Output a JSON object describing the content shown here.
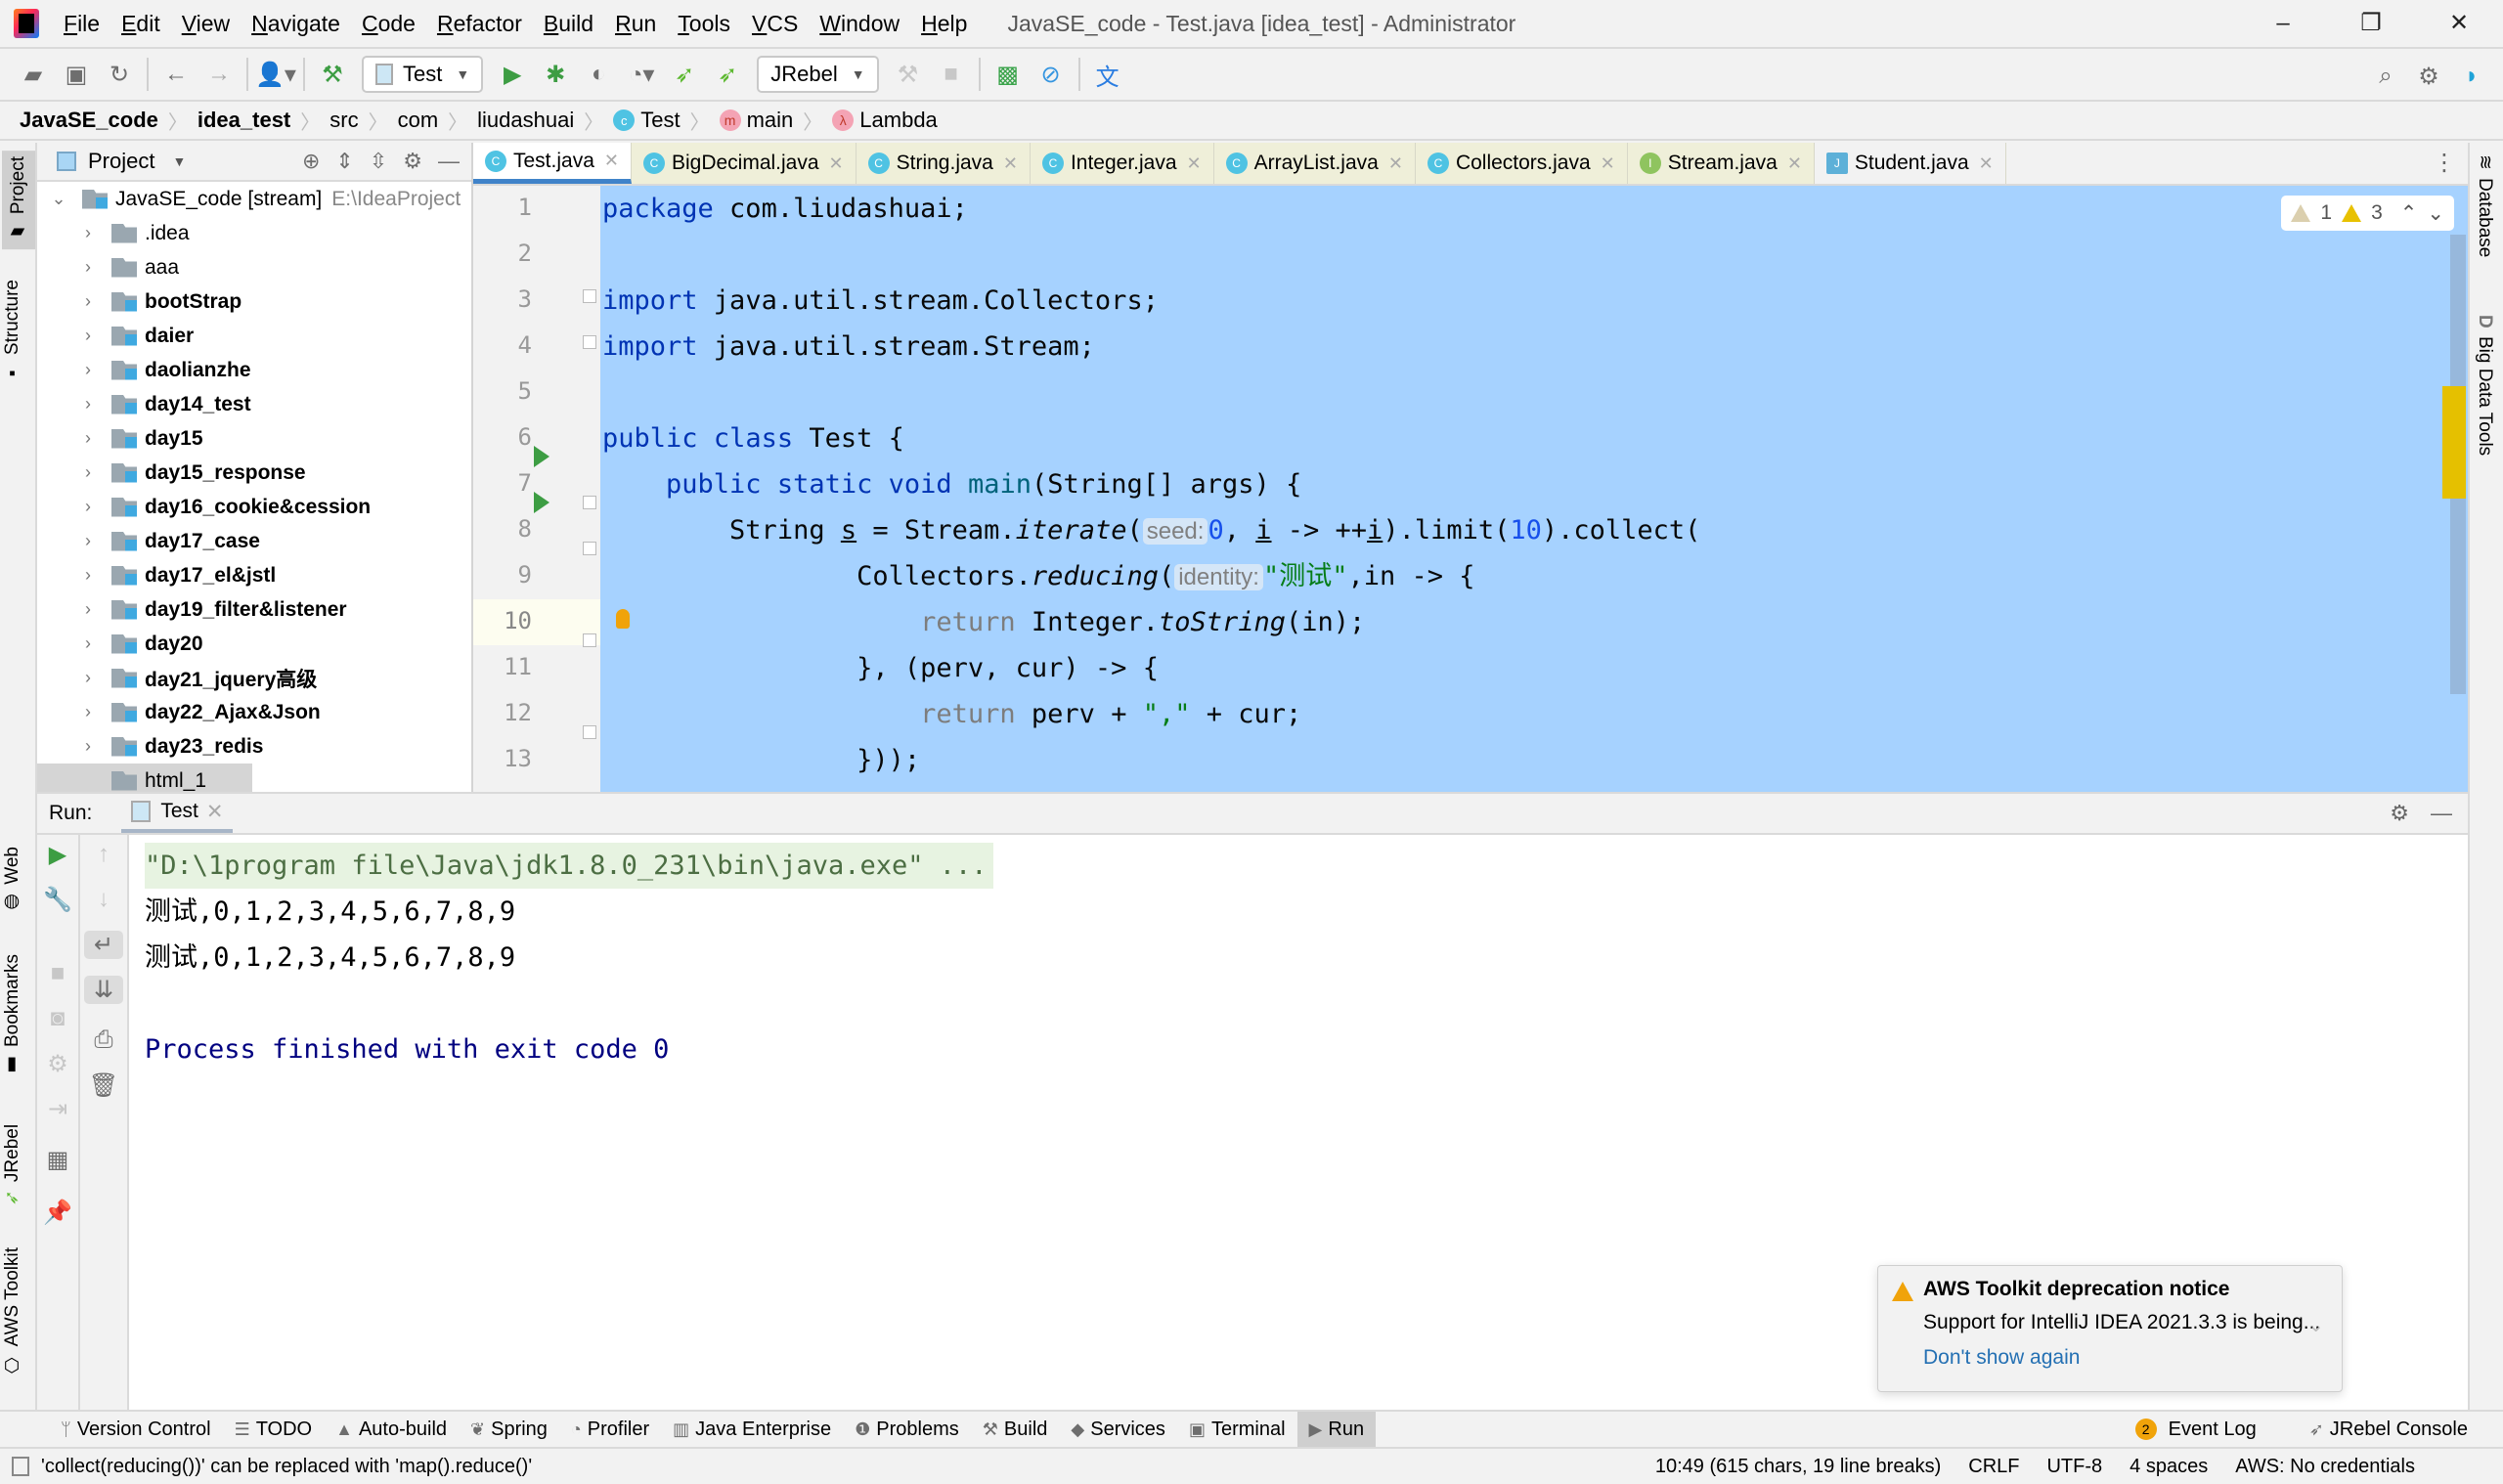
{
  "window": {
    "title": "JavaSE_code - Test.java [idea_test] - Administrator",
    "controls": {
      "minimize": "–",
      "restore": "❐",
      "close": "✕"
    }
  },
  "menu": [
    "File",
    "Edit",
    "View",
    "Navigate",
    "Code",
    "Refactor",
    "Build",
    "Run",
    "Tools",
    "VCS",
    "Window",
    "Help"
  ],
  "toolbar": {
    "run_config": "Test",
    "jrebel_config": "JRebel",
    "icons": [
      "open-icon",
      "save-icon",
      "sync-icon",
      "back-icon",
      "forward-icon",
      "user-icon",
      "build-hammer-icon",
      "run-icon",
      "debug-icon",
      "coverage-icon",
      "profile-icon",
      "jrebel-run-icon",
      "jrebel-debug-icon",
      "rebuild-icon",
      "stop-icon",
      "monitor-icon",
      "power-save-icon",
      "translate-icon",
      "search-icon",
      "settings-icon",
      "toolbox-icon"
    ]
  },
  "breadcrumb": [
    {
      "label": "JavaSE_code",
      "bold": true
    },
    {
      "label": "idea_test",
      "bold": true
    },
    {
      "label": "src"
    },
    {
      "label": "com"
    },
    {
      "label": "liudashuai"
    },
    {
      "label": "Test",
      "icon": "class"
    },
    {
      "label": "main",
      "icon": "method"
    },
    {
      "label": "Lambda",
      "icon": "lambda"
    }
  ],
  "left_stripe": {
    "project": "Project",
    "structure": "Structure",
    "web": "Web",
    "bookmarks": "Bookmarks",
    "jrebel": "JRebel",
    "aws": "AWS Toolkit"
  },
  "right_stripe": {
    "database": "Database",
    "bigdata": "Big Data Tools"
  },
  "project_panel": {
    "title": "Project",
    "root": {
      "name": "JavaSE_code [stream]",
      "path": "E:\\IdeaProject"
    },
    "items": [
      {
        "name": ".idea",
        "module": false
      },
      {
        "name": "aaa",
        "module": false
      },
      {
        "name": "bootStrap",
        "module": true
      },
      {
        "name": "daier",
        "module": true
      },
      {
        "name": "daolianzhe",
        "module": true
      },
      {
        "name": "day14_test",
        "module": true
      },
      {
        "name": "day15",
        "module": true
      },
      {
        "name": "day15_response",
        "module": true
      },
      {
        "name": "day16_cookie&cession",
        "module": true
      },
      {
        "name": "day17_case",
        "module": true
      },
      {
        "name": "day17_el&jstl",
        "module": true
      },
      {
        "name": "day19_filter&listener",
        "module": true
      },
      {
        "name": "day20",
        "module": true
      },
      {
        "name": "day21_jquery高级",
        "module": true
      },
      {
        "name": "day22_Ajax&Json",
        "module": true
      },
      {
        "name": "day23_redis",
        "module": true
      },
      {
        "name": "html_1",
        "module": false
      }
    ]
  },
  "tabs": [
    {
      "label": "Test.java",
      "icon": "C",
      "active": true
    },
    {
      "label": "BigDecimal.java",
      "icon": "C"
    },
    {
      "label": "String.java",
      "icon": "C"
    },
    {
      "label": "Integer.java",
      "icon": "C"
    },
    {
      "label": "ArrayList.java",
      "icon": "C"
    },
    {
      "label": "Collectors.java",
      "icon": "C"
    },
    {
      "label": "Stream.java",
      "icon": "I"
    },
    {
      "label": "Student.java",
      "icon": "J"
    }
  ],
  "editor": {
    "line_numbers": [
      "1",
      "2",
      "3",
      "4",
      "5",
      "6",
      "7",
      "8",
      "9",
      "10",
      "11",
      "12",
      "13"
    ],
    "current_line": "10",
    "inspections": {
      "weak_warnings": "1",
      "warnings": "3"
    },
    "hints": {
      "seed": "seed:",
      "identity": "identity:"
    },
    "code": {
      "l1": [
        "package",
        " com.liudashuai;"
      ],
      "l3": [
        "import",
        " java.util.stream.Collectors;"
      ],
      "l4": [
        "import",
        " java.util.stream.Stream;"
      ],
      "l6": [
        "public",
        "class",
        "Test",
        " {"
      ],
      "l7": [
        "public",
        "static",
        "void",
        "main",
        "(String[] args) {"
      ],
      "l8": [
        "String ",
        "s",
        " = Stream.",
        "iterate",
        "(",
        "0",
        ", ",
        "i",
        " -> ++",
        "i",
        ").limit(",
        "10",
        ").collect("
      ],
      "l9": [
        "Collectors.",
        "reducing",
        "(",
        "\"测试\"",
        ",in -> {"
      ],
      "l10": [
        "return",
        " Integer.",
        "toString",
        "(in);"
      ],
      "l11": [
        "}, (perv, cur) -> {"
      ],
      "l12": [
        "return",
        " perv + ",
        "\",\"",
        " + cur;"
      ],
      "l13": [
        "}));"
      ]
    }
  },
  "run_panel": {
    "label": "Run:",
    "tab": "Test",
    "console": [
      "\"D:\\1program file\\Java\\jdk1.8.0_231\\bin\\java.exe\" ...",
      "测试,0,1,2,3,4,5,6,7,8,9",
      "测试,0,1,2,3,4,5,6,7,8,9",
      "",
      "Process finished with exit code 0"
    ]
  },
  "notification": {
    "title": "AWS Toolkit deprecation notice",
    "body": "Support for IntelliJ IDEA 2021.3.3 is being...",
    "link": "Don't show again"
  },
  "tool_windows": [
    {
      "label": "Version Control",
      "icon": "vcs-icon"
    },
    {
      "label": "TODO",
      "icon": "list-icon"
    },
    {
      "label": "Auto-build",
      "icon": "warning-icon"
    },
    {
      "label": "Spring",
      "icon": "spring-icon"
    },
    {
      "label": "Profiler",
      "icon": "profiler-icon"
    },
    {
      "label": "Java Enterprise",
      "icon": "enterprise-icon"
    },
    {
      "label": "Problems",
      "icon": "problems-icon"
    },
    {
      "label": "Build",
      "icon": "hammer-icon"
    },
    {
      "label": "Services",
      "icon": "services-icon"
    },
    {
      "label": "Terminal",
      "icon": "terminal-icon"
    },
    {
      "label": "Run",
      "icon": "run-icon",
      "active": true
    }
  ],
  "tool_windows_right": {
    "event_log": "Event Log",
    "event_count": "2",
    "jrebel_console": "JRebel Console"
  },
  "status_bar": {
    "message": "'collect(reducing())' can be replaced with 'map().reduce()'",
    "position": "10:49 (615 chars, 19 line breaks)",
    "line_sep": "CRLF",
    "encoding": "UTF-8",
    "indent": "4 spaces",
    "aws": "AWS: No credentials"
  }
}
